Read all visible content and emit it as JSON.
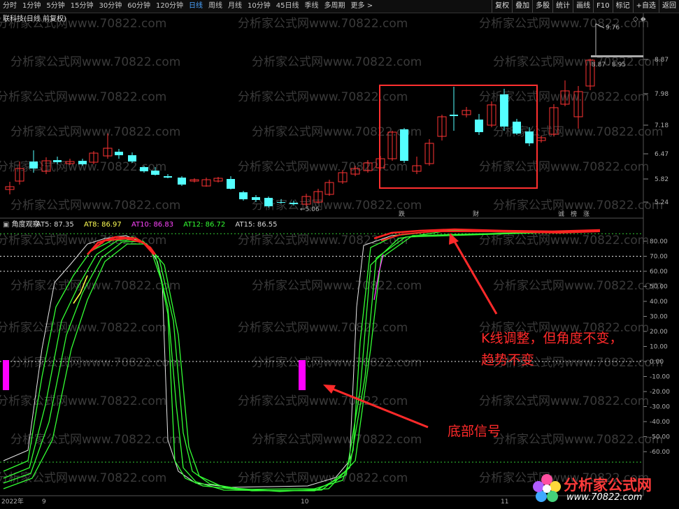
{
  "toolbar": {
    "period_tabs": [
      "分时",
      "1分钟",
      "5分钟",
      "15分钟",
      "30分钟",
      "60分钟",
      "120分钟",
      "日线",
      "周线",
      "月线",
      "10分钟",
      "45日线",
      "季线",
      "多周期",
      "更多 >"
    ],
    "active_tab": "日线",
    "right_buttons": [
      "复权",
      "叠加",
      "多股",
      "统计",
      "画线",
      "F10",
      "标记",
      "+自选",
      "返回"
    ]
  },
  "main_panel": {
    "title": "联科技(日线 前复权)",
    "price_axis_labels": [
      "8.87",
      "7.98",
      "7.18",
      "6.47",
      "5.82",
      "5.24"
    ],
    "high_marker": "9.76",
    "low_marker": "5.06",
    "price_range_label": "8.87 - 8.95",
    "signal_tags": [
      {
        "text": "跌",
        "color": "#33dd55"
      },
      {
        "text": "财",
        "color": "#5fd8ff"
      },
      {
        "text": "诚",
        "color": "#33dd55"
      },
      {
        "text": "榜",
        "color": "#ff5555"
      },
      {
        "text": "涨",
        "color": "#ff5555"
      }
    ]
  },
  "indicator_panel": {
    "name": "角度观察",
    "values": [
      {
        "label": "AT5: 87.35",
        "color": "#d8d8d8"
      },
      {
        "label": "AT8: 86.97",
        "color": "#ffff55"
      },
      {
        "label": "AT10: 86.83",
        "color": "#ff44ff"
      },
      {
        "label": "AT12: 86.72",
        "color": "#33ff33"
      },
      {
        "label": "AT15: 86.55",
        "color": "#d8d8d8"
      }
    ],
    "axis_labels": [
      "80.00",
      "70.00",
      "60.00",
      "50.00",
      "40.00",
      "30.00",
      "20.00",
      "10.00",
      "0.00",
      "-10.00",
      "-20.00",
      "-30.00",
      "-40.00",
      "-50.00",
      "-60.00"
    ]
  },
  "date_labels": [
    "2022年",
    "9",
    "10",
    "11"
  ],
  "annotations": {
    "line1": "K线调整，但角度不变，",
    "line2": "趋势不变",
    "bottom_signal": "底部信号"
  },
  "watermark": "分析家公式网www.70822.com",
  "logo": {
    "brand": "分析家公式网",
    "url": "www.70822.com"
  },
  "colors": {
    "up": "#ff3333",
    "down": "#54ffff",
    "highlight_box": "#ff3030",
    "signal_bar": "#ff00ff"
  }
}
